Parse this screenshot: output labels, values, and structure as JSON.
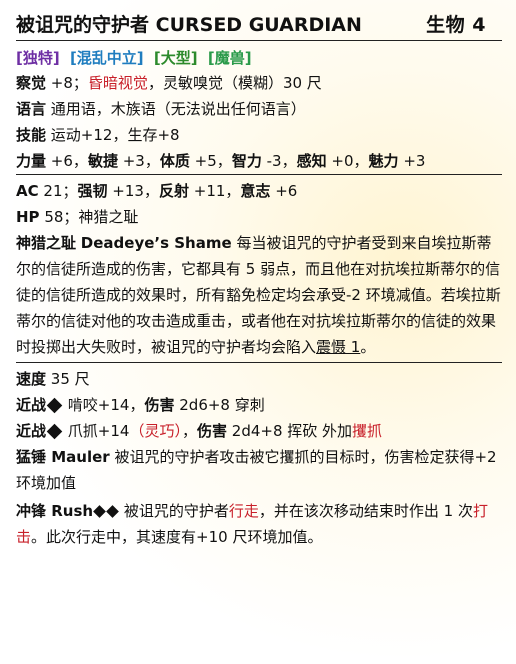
{
  "header": {
    "name": "被诅咒的守护者",
    "name_en": "CURSED GUARDIAN",
    "type_level": "生物 4"
  },
  "traits": [
    "[独特]",
    "[混乱中立]",
    "[大型]",
    "[魔兽]"
  ],
  "perception": {
    "label": "察觉",
    "value": "+8；",
    "special": "昏暗视觉",
    "rest": "，灵敏嗅觉（模糊）30 尺"
  },
  "languages": {
    "label": "语言",
    "value": "通用语，木族语（无法说出任何语言）"
  },
  "skills": {
    "label": "技能",
    "value": "运动+12，生存+8"
  },
  "attributes": [
    {
      "label": "力量",
      "value": "+6"
    },
    {
      "label": "敏捷",
      "value": "+3"
    },
    {
      "label": "体质",
      "value": "+5"
    },
    {
      "label": "智力",
      "value": "-3"
    },
    {
      "label": "感知",
      "value": "+0"
    },
    {
      "label": "魅力",
      "value": "+3"
    }
  ],
  "defense": {
    "ac_label": "AC",
    "ac_value": "21；",
    "fort_label": "强韧",
    "fort_value": "+13，",
    "ref_label": "反射",
    "ref_value": "+11，",
    "will_label": "意志",
    "will_value": "+6"
  },
  "hp": {
    "label": "HP",
    "value": "58；神猎之耻"
  },
  "shame": {
    "label": "神猎之耻",
    "label_en": "Deadeye’s Shame",
    "text_1": "每当被诅咒的守护者受到来自埃拉斯蒂尔的信徒所造成的伤害，它都具有 5 弱点，而且他在对抗埃拉斯蒂尔的信徒的信徒所造成的效果时，所有豁免检定均会承受-2 环境减值。若埃拉斯蒂尔的信徒对他的攻击造成重击，或者他在对抗埃拉斯蒂尔的信徒的效果时投掷出大失败时，被诅咒的守护者均会陷入",
    "link": "震慑 1",
    "text_2": "。"
  },
  "speed": {
    "label": "速度",
    "value": "35 尺"
  },
  "strike_bite": {
    "label": "近战",
    "name": "啃咬+14，",
    "damage_label": "伤害",
    "damage": "2d6+8 穿刺"
  },
  "strike_claw": {
    "label": "近战",
    "name": "爪抓+14",
    "trait": "（灵巧）",
    "sep": "，",
    "damage_label": "伤害",
    "damage": "2d4+8 挥砍 外加",
    "extra": "攫抓"
  },
  "mauler": {
    "label": "猛锤 Mauler",
    "text": "被诅咒的守护者攻击被它攫抓的目标时，伤害检定获得+2 环境加值"
  },
  "rush": {
    "label": "冲锋 Rush",
    "t1": "被诅咒的守护者",
    "a1": "行走",
    "t2": "，并在该次移动结束时作出 1 次",
    "a2": "打击",
    "t3": "。此次行走中，其速度有+10 尺环境加值。"
  }
}
